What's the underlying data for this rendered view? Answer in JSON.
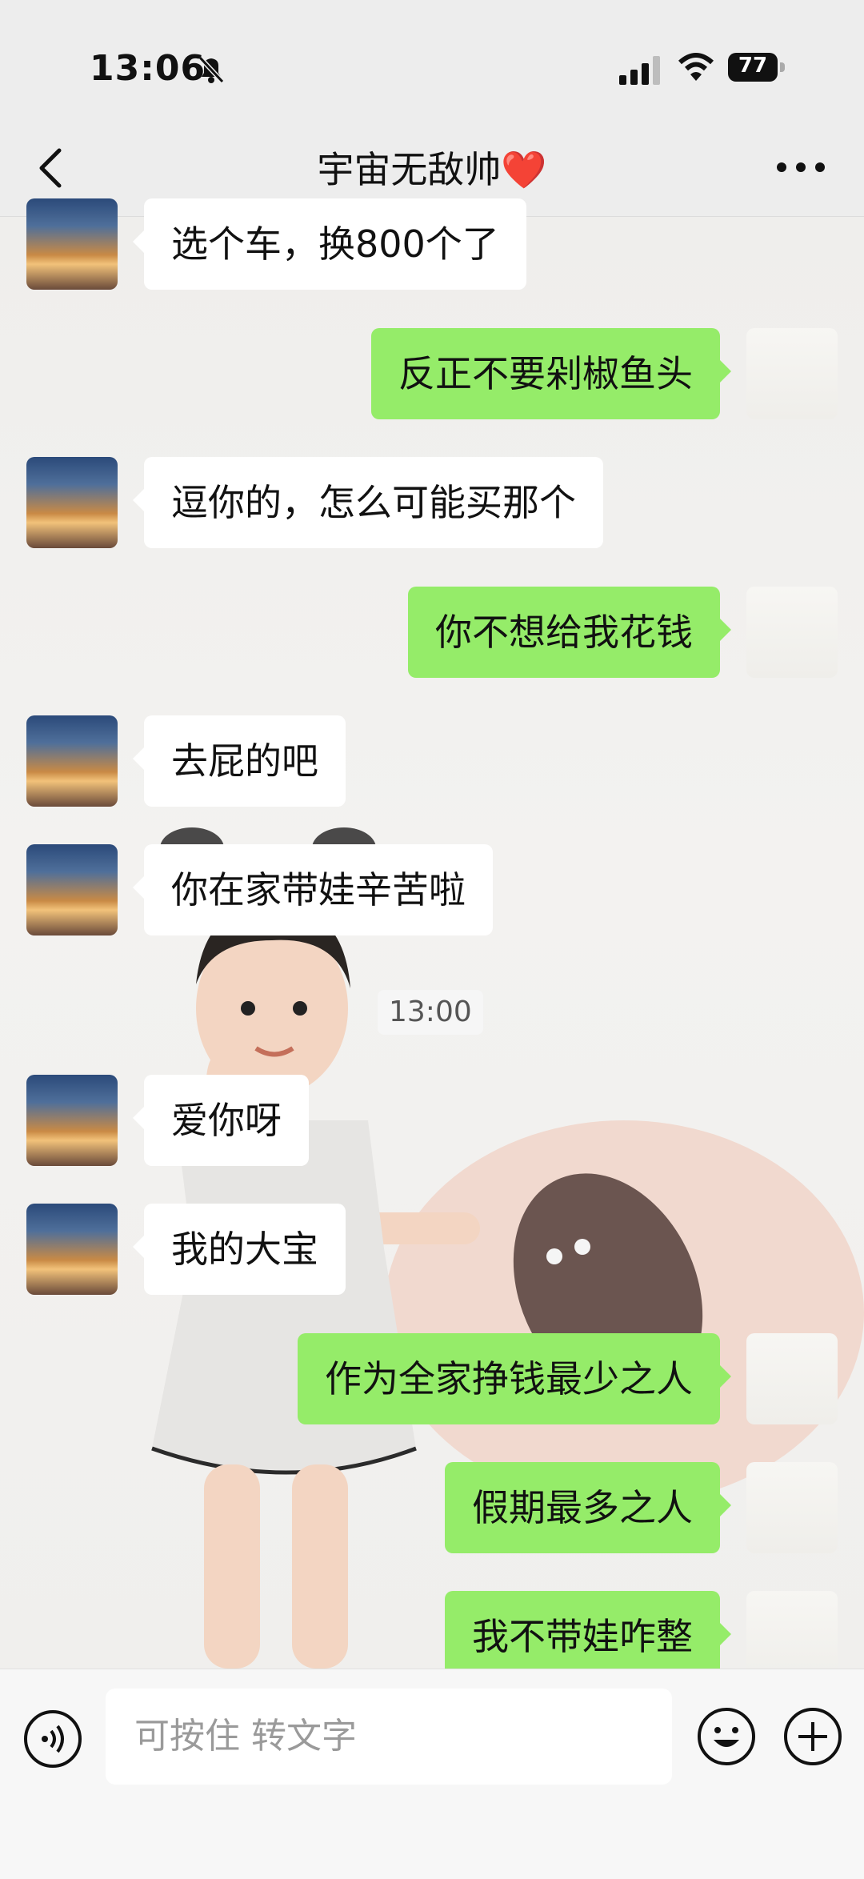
{
  "status_bar": {
    "time": "13:06",
    "battery": "77",
    "icons": [
      "bell-slash-icon",
      "signal-icon",
      "wifi-icon",
      "battery-icon"
    ]
  },
  "header": {
    "title": "宇宙无敌帅❤️",
    "back_icon": "chevron-left-icon",
    "more_icon": "more-dots-icon"
  },
  "messages": [
    {
      "side": "left",
      "text": "选个车，换800个了"
    },
    {
      "side": "right",
      "text": "反正不要剁椒鱼头"
    },
    {
      "side": "left",
      "text": "逗你的，怎么可能买那个"
    },
    {
      "side": "right",
      "text": "你不想给我花钱"
    },
    {
      "side": "left",
      "text": "去屁的吧"
    },
    {
      "side": "left",
      "text": "你在家带娃辛苦啦"
    },
    {
      "side": "left",
      "text": "爱你呀"
    },
    {
      "side": "left",
      "text": "我的大宝"
    },
    {
      "side": "right",
      "text": "作为全家挣钱最少之人"
    },
    {
      "side": "right",
      "text": "假期最多之人"
    },
    {
      "side": "right",
      "text": "我不带娃咋整"
    }
  ],
  "timestamp": "13:00",
  "input_bar": {
    "placeholder": "可按住 转文字",
    "voice_icon": "voice-icon",
    "emoji_icon": "emoji-icon",
    "plus_icon": "plus-icon"
  },
  "colors": {
    "sent_bubble": "#95ec69",
    "received_bubble": "#ffffff",
    "bar_background": "#ededed"
  }
}
